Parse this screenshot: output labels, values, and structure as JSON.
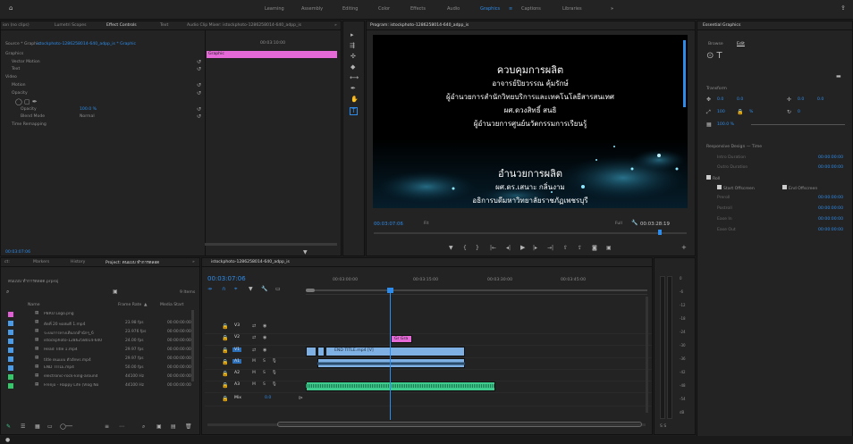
{
  "app": {
    "home_icon": "home-icon"
  },
  "workspaces": [
    "Learning",
    "Assembly",
    "Editing",
    "Color",
    "Effects",
    "Audio",
    "Graphics",
    "Captions",
    "Libraries"
  ],
  "workspace_active": "Graphics",
  "workspace_overflow": "»",
  "effect_controls": {
    "tabs": [
      "ion (no clips)",
      "Lumetri Scopes",
      "Effect Controls",
      "Text",
      "Audio Clip Mixer: istockphoto-1286258014-640_adpp_is"
    ],
    "tabs_more": "»",
    "source_label": "Source * Graphic",
    "sequence_label": "istockphoto-1286258014-640_adpp_is * Graphic",
    "timecode": "00:03:10:00",
    "clip_label": "Graphic",
    "section_graphics": "Graphics",
    "vector_motion": "Vector Motion",
    "text_label": "Text",
    "section_video": "Video",
    "motion": "Motion",
    "opacity": "Opacity",
    "opacity_param": "Opacity",
    "opacity_value": "100.0 %",
    "blend_mode_label": "Blend Mode",
    "blend_mode_value": "Normal",
    "time_remapping": "Time Remapping",
    "current_time": "00:03:07:06"
  },
  "program": {
    "title": "Program: istockphoto-1286258014-640_adpp_is",
    "credits_top": [
      "ควบคุมการผลิต",
      "อาจารย์ปิยวรรณ คุ้มรักษ์",
      "ผู้อำนวยการสำนักวิทยบริการและเทคโนโลยีสารสนเทศ",
      "ผศ.ดวงสิทธิ์ สนธิ",
      "ผู้อำนวยการศูนย์นวัตกรรมการเรียนรู้"
    ],
    "credits_bottom": [
      "อำนวยการผลิต",
      "ผศ.ดร.เสนาะ กลิ่นงาม",
      "อธิการบดีมหาวิทยาลัยราชภัฏเพชรบุรี"
    ],
    "timecode_current": "00:03:07:06",
    "fit": "Fit",
    "quality": "Full",
    "timecode_duration": "00:03:28:19"
  },
  "essential_graphics": {
    "title": "Essential Graphics",
    "tab_browse": "Browse",
    "tab_edit": "Edit",
    "transform_label": "Transform",
    "pos_x": "0.0",
    "pos_y": "0.0",
    "anchor_x": "0.0",
    "anchor_y": "0.0",
    "scale": "100",
    "rotation": "0",
    "opacity_value": "100.0 %",
    "responsive_label": "Responsive Design — Time",
    "intro_duration": "Intro Duration",
    "intro_value": "00:00:00:00",
    "outro_duration": "Outro Duration",
    "outro_value": "00:00:00:00",
    "roll": "Roll",
    "start_offscreen": "Start Offscreen",
    "end_offscreen": "End Offscreen",
    "preroll": "Preroll",
    "preroll_value": "00:00:00:00",
    "postroll": "Postroll",
    "postroll_value": "00:00:00:00",
    "ease_in": "Ease In",
    "ease_in_value": "00:00:00:00",
    "ease_out": "Ease Out",
    "ease_out_value": "00:00:00:00"
  },
  "project": {
    "tabs": [
      "ct:",
      "Markers",
      "History",
      "Project: ตนแบบ ทำการตลอด"
    ],
    "tabs_more": "»",
    "file_name": "ตนแบบ ทำการตลอด.prproj",
    "items_count": "9 Items",
    "col_name": "Name",
    "col_frame_rate": "Frame Rate",
    "col_media_start": "Media Start",
    "rows": [
      {
        "name": "PBRU Logo.png",
        "fps": "",
        "start": "",
        "color": "#e15fd4"
      },
      {
        "name": "ตัดที่ 20 หอสมดี 1.mp4",
        "fps": "23.98 fps",
        "start": "00:00:00:00",
        "color": "#4a9ce8"
      },
      {
        "name": "ระบบการทางเดินรถสำนักๆ_6",
        "fps": "23.976 fps",
        "start": "00:00:00:00",
        "color": "#4a9ce8"
      },
      {
        "name": "istockphoto-1286258014-640",
        "fps": "24.00 fps",
        "start": "00:00:00:00",
        "color": "#4a9ce8"
      },
      {
        "name": "Head Title 1.mp4",
        "fps": "29.97 fps",
        "start": "00:00:00:00",
        "color": "#4a9ce8"
      },
      {
        "name": "title ตนแบบ ตัวอักษร.mp4",
        "fps": "29.97 fps",
        "start": "00:00:00:00",
        "color": "#4a9ce8"
      },
      {
        "name": "END TITLE.mp4",
        "fps": "50.00 fps",
        "start": "00:00:00:00",
        "color": "#4a9ce8"
      },
      {
        "name": "electronic-rock-king-around",
        "fps": "44100 Hz",
        "start": "00:00:00:00",
        "color": "#35c86a"
      },
      {
        "name": "Frenjo - Happy Life (Vlog No",
        "fps": "44100 Hz",
        "start": "00:00:00:00",
        "color": "#35c86a"
      }
    ]
  },
  "timeline": {
    "tab": "istockphoto-1286258014-640_adpp_is",
    "timecode": "00:03:07:06",
    "ruler": [
      "00:03:00:00",
      "00:03:15:00",
      "00:03:30:00",
      "00:03:45:00"
    ],
    "tracks": [
      "V3",
      "V2",
      "V1",
      "A1",
      "A2",
      "A3",
      "Mix"
    ],
    "mix_value": "0.0",
    "clip_graphic_label": "Gr Gra",
    "clip_end_label": "END TITLE.mp4 [V]"
  },
  "audio_meter": {
    "labels": [
      "0",
      "-6",
      "-12",
      "-18",
      "-24",
      "-30",
      "-36",
      "-42",
      "-48",
      "-54",
      "dB"
    ],
    "solo": "S  S"
  },
  "colors": {
    "accent": "#2d8ceb",
    "pink": "#e56ad8",
    "clip_blue": "#7fb0e3",
    "audio_green": "#3ecb8e"
  }
}
